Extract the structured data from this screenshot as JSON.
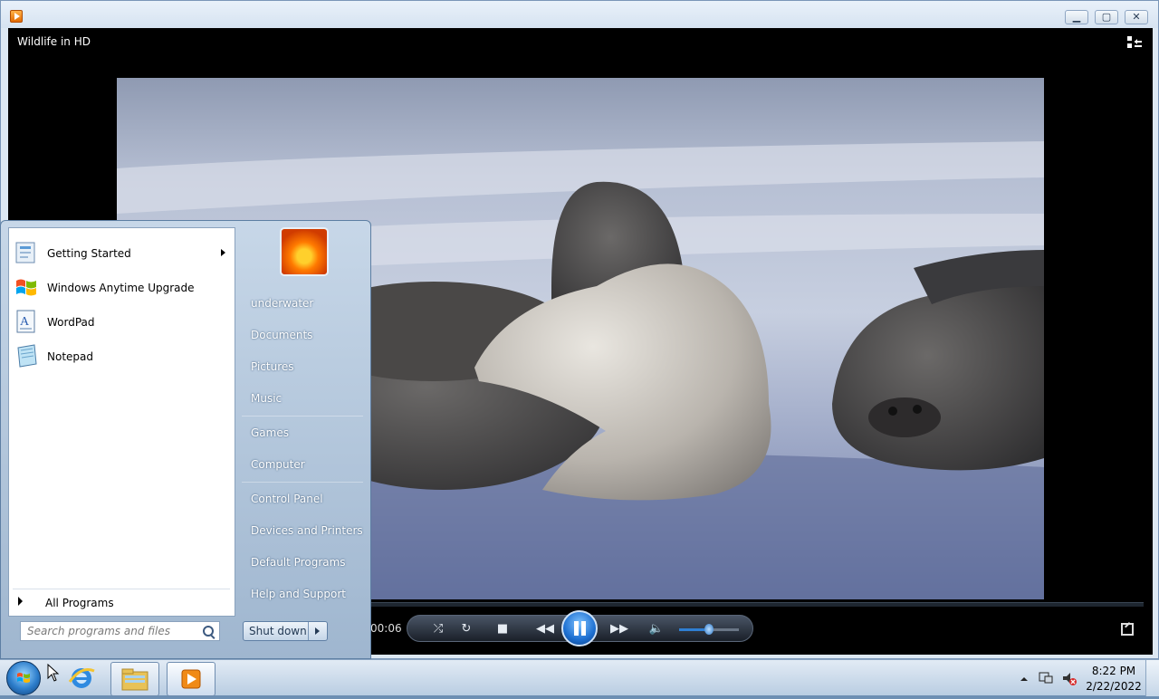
{
  "window": {
    "video_title": "Wildlife in HD",
    "min_glyph": "▁",
    "max_glyph": "▢",
    "close_glyph": "✕"
  },
  "player": {
    "time": "00:06",
    "volume_level": 0.5,
    "seek_progress": 0.0
  },
  "start_menu": {
    "programs": [
      {
        "label": "Getting Started",
        "icon": "getting-started-icon",
        "has_submenu": true
      },
      {
        "label": "Windows Anytime Upgrade",
        "icon": "windows-flag-icon",
        "has_submenu": false
      },
      {
        "label": "WordPad",
        "icon": "wordpad-icon",
        "has_submenu": false
      },
      {
        "label": "Notepad",
        "icon": "notepad-icon",
        "has_submenu": false
      }
    ],
    "all_programs": "All Programs",
    "search_placeholder": "Search programs and files",
    "right_items": [
      "underwater",
      "Documents",
      "Pictures",
      "Music",
      "Games",
      "Computer",
      "Control Panel",
      "Devices and Printers",
      "Default Programs",
      "Help and Support"
    ],
    "shutdown_label": "Shut down"
  },
  "taskbar": {
    "time": "8:22 PM",
    "date": "2/22/2022"
  },
  "colors": {
    "taskbar": "#c9d9ea",
    "start_menu_right": "#a9bfd6",
    "player_bg": "#000000",
    "accent_blue": "#1d6fd1"
  }
}
